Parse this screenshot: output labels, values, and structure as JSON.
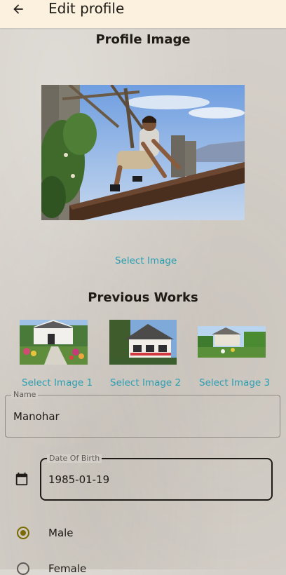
{
  "app_bar": {
    "title": "Edit profile",
    "back_icon": "arrow-back-icon"
  },
  "profile_image": {
    "section_title": "Profile Image",
    "select_label": "Select Image"
  },
  "previous_works": {
    "section_title": "Previous Works",
    "items": [
      {
        "select_label": "Select Image 1"
      },
      {
        "select_label": "Select Image 2"
      },
      {
        "select_label": "Select Image 3"
      }
    ]
  },
  "form": {
    "name": {
      "label": "Name",
      "value": "Manohar"
    },
    "date_of_birth": {
      "label": "Date Of Birth",
      "value": "1985-01-19",
      "icon": "calendar-icon"
    },
    "gender": {
      "options": [
        {
          "label": "Male",
          "selected": true
        },
        {
          "label": "Female",
          "selected": false
        }
      ]
    }
  },
  "colors": {
    "app_bar_bg": "#fbf1de",
    "link": "#2b9eb0",
    "radio_selected": "#7a6a00",
    "background": "#d4cfc8"
  }
}
